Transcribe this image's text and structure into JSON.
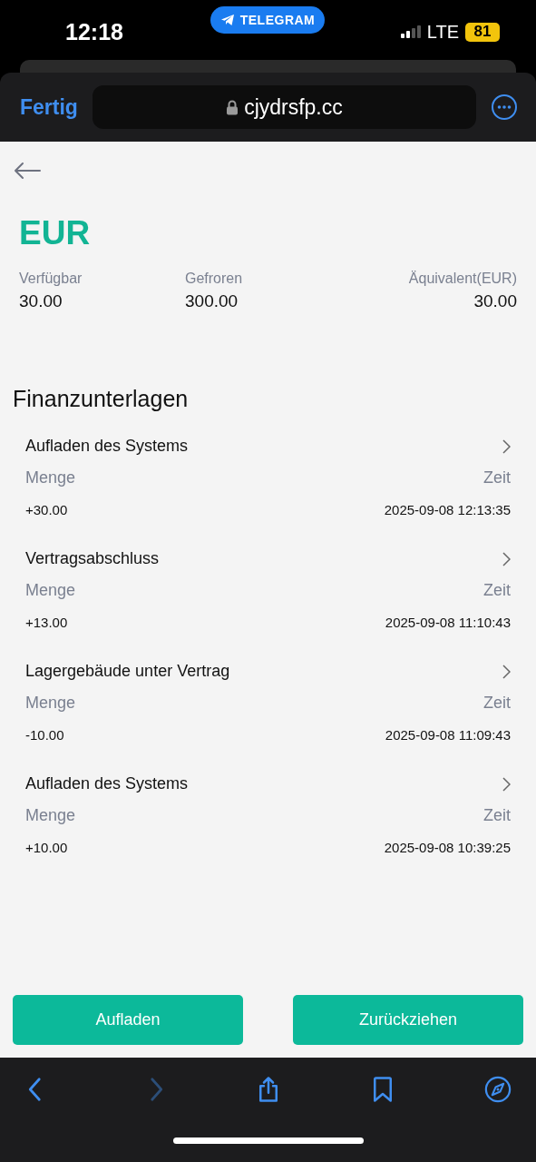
{
  "status_bar": {
    "time": "12:18",
    "app_pill": "TELEGRAM",
    "network": "LTE",
    "battery": "81"
  },
  "browser_bar": {
    "done": "Fertig",
    "url": "cjydrsfp.cc"
  },
  "currency": "EUR",
  "balances": [
    {
      "label": "Verfügbar",
      "value": "30.00"
    },
    {
      "label": "Gefroren",
      "value": "300.00"
    },
    {
      "label": "Äquivalent(EUR)",
      "value": "30.00"
    }
  ],
  "records_title": "Finanzunterlagen",
  "records": [
    {
      "title": "Aufladen des Systems",
      "amount_label": "Menge",
      "time_label": "Zeit",
      "amount": "+30.00",
      "time": "2025-09-08 12:13:35"
    },
    {
      "title": "Vertragsabschluss",
      "amount_label": "Menge",
      "time_label": "Zeit",
      "amount": "+13.00",
      "time": "2025-09-08 11:10:43"
    },
    {
      "title": "Lagergebäude unter Vertrag",
      "amount_label": "Menge",
      "time_label": "Zeit",
      "amount": "-10.00",
      "time": "2025-09-08 11:09:43"
    },
    {
      "title": "Aufladen des Systems",
      "amount_label": "Menge",
      "time_label": "Zeit",
      "amount": "+10.00",
      "time": "2025-09-08 10:39:25"
    }
  ],
  "actions": [
    "Aufladen",
    "Zurückziehen"
  ],
  "toolbar": [
    {
      "kind": "back",
      "disabled": false
    },
    {
      "kind": "forward",
      "disabled": true
    },
    {
      "kind": "share",
      "disabled": false
    },
    {
      "kind": "bookmarks",
      "disabled": false
    },
    {
      "kind": "compass",
      "disabled": false
    }
  ]
}
